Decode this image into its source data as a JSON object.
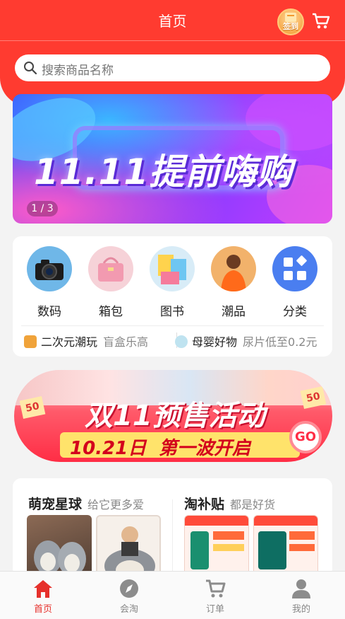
{
  "header": {
    "title": "首页",
    "signin_label": "签到"
  },
  "search": {
    "placeholder": "搜索商品名称"
  },
  "banner1": {
    "headline": "11.11提前嗨购",
    "pager": "1 / 3"
  },
  "categories": [
    {
      "label": "数码",
      "icon": "camera-icon"
    },
    {
      "label": "箱包",
      "icon": "handbag-icon"
    },
    {
      "label": "图书",
      "icon": "books-icon"
    },
    {
      "label": "潮品",
      "icon": "fashion-icon"
    },
    {
      "label": "分类",
      "icon": "grid-icon"
    }
  ],
  "promos": [
    {
      "title": "二次元潮玩",
      "sub": "盲盒乐高"
    },
    {
      "title": "母婴好物",
      "sub": "尿片低至0.2元"
    }
  ],
  "banner2": {
    "headline": "双11预售活动",
    "date": "10.21日",
    "tagline": "第一波开启",
    "go": "GO",
    "tag": "50"
  },
  "sections": [
    {
      "title": "萌宠星球",
      "sub": "给它更多爱"
    },
    {
      "title": "淘补贴",
      "sub": "都是好货"
    }
  ],
  "tabs": [
    {
      "label": "首页"
    },
    {
      "label": "会淘"
    },
    {
      "label": "订单"
    },
    {
      "label": "我的"
    }
  ],
  "colors": {
    "brand_red": "#ff3b30",
    "active_tab": "#e6302b"
  }
}
